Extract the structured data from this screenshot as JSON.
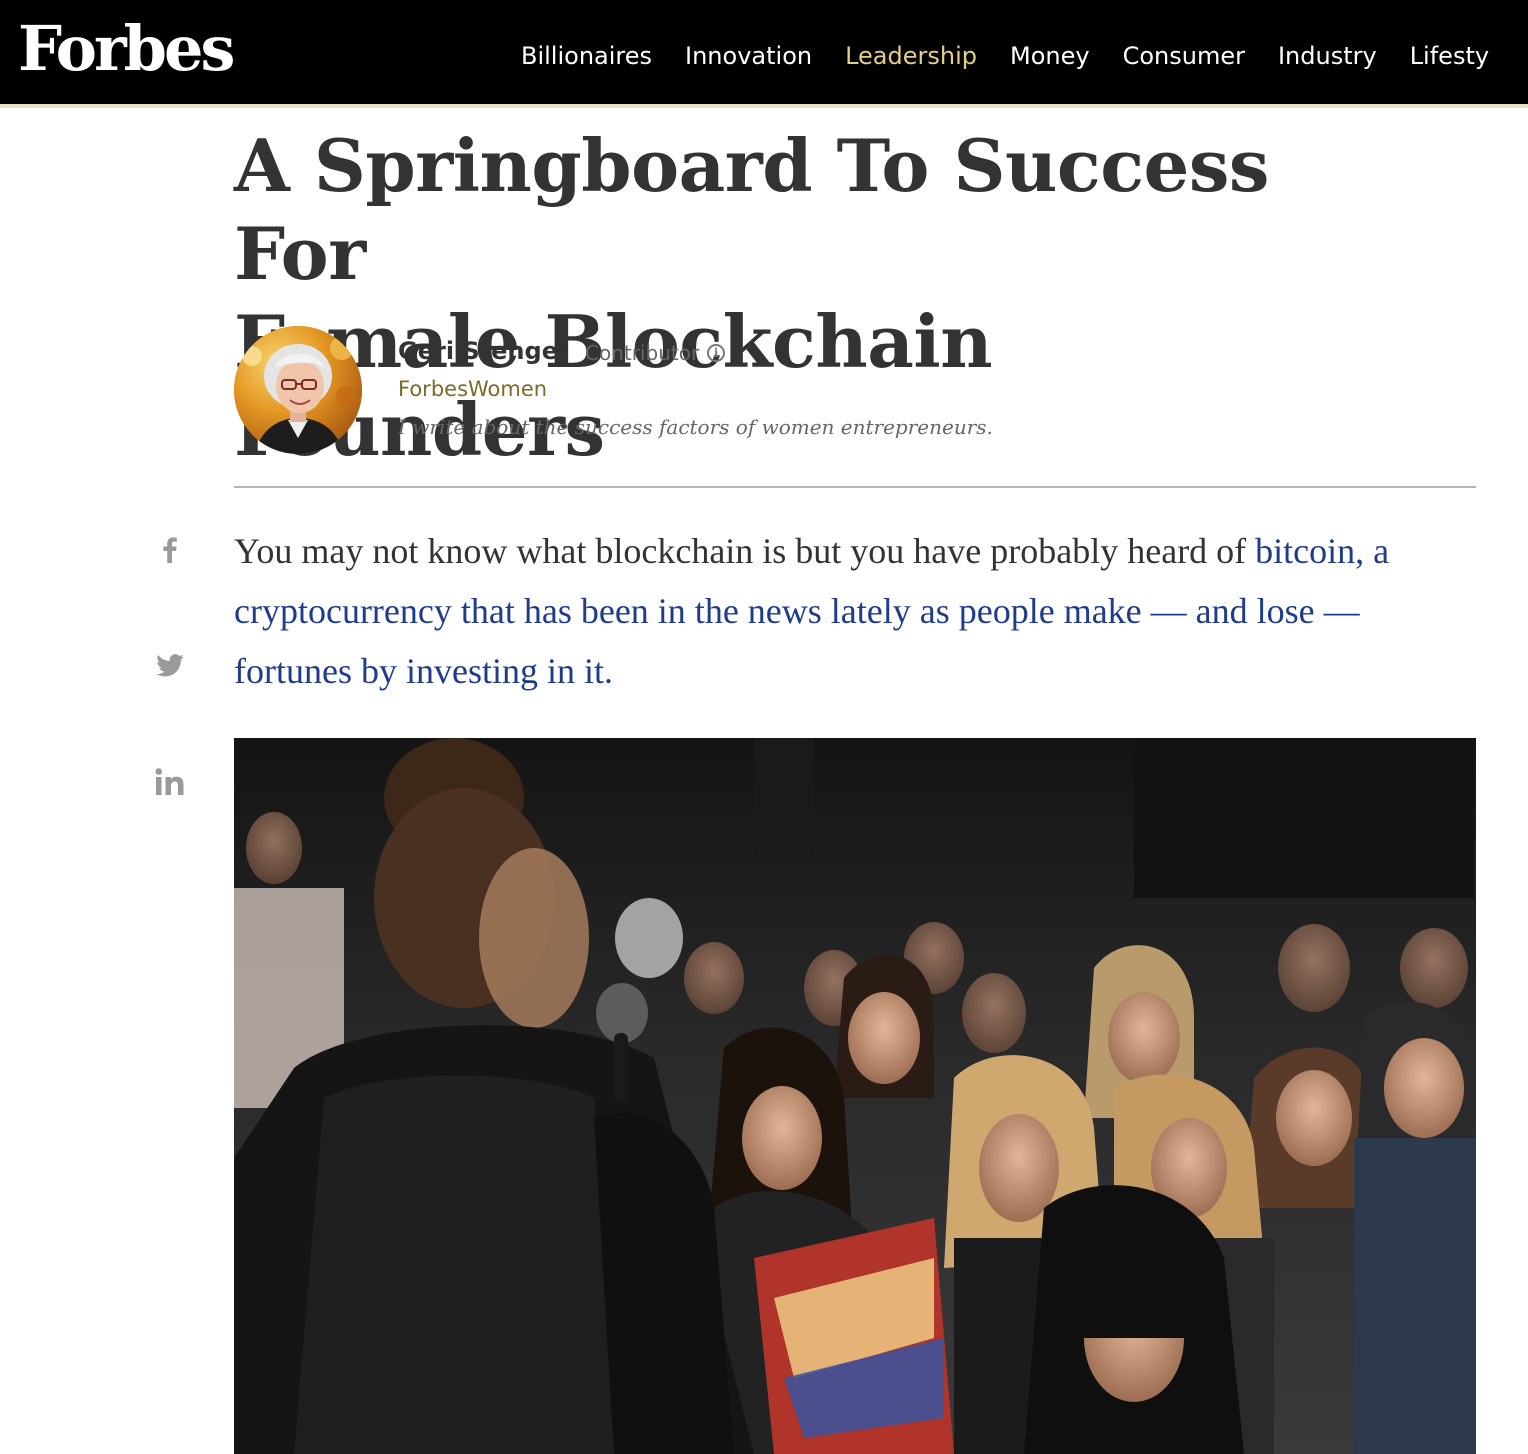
{
  "brand": {
    "logo": "Forbes"
  },
  "nav": {
    "items": [
      {
        "label": "Billionaires",
        "active": false
      },
      {
        "label": "Innovation",
        "active": false
      },
      {
        "label": "Leadership",
        "active": true
      },
      {
        "label": "Money",
        "active": false
      },
      {
        "label": "Consumer",
        "active": false
      },
      {
        "label": "Industry",
        "active": false
      },
      {
        "label": "Lifesty",
        "active": false
      }
    ]
  },
  "article": {
    "title_line1": "A Springboard To Success For",
    "title_line2": "Female Blockchain Founders",
    "author": {
      "name": "Geri Stengel",
      "role": "Contributor",
      "channel": "ForbesWomen",
      "bio": "I write about the success factors of women entrepreneurs."
    },
    "lede": {
      "plain": "You may not know what blockchain is but you have probably heard of ",
      "link": "bitcoin, a cryptocurrency that has been in the news lately as people make — and lose — fortunes by investing in it."
    }
  },
  "share": {
    "icons": [
      "facebook-icon",
      "twitter-icon",
      "linkedin-icon"
    ]
  },
  "colors": {
    "topbar": "#000000",
    "nav_active": "#e3cf86",
    "channel": "#7d6a28",
    "link": "#1f3b8c",
    "text": "#333333"
  }
}
